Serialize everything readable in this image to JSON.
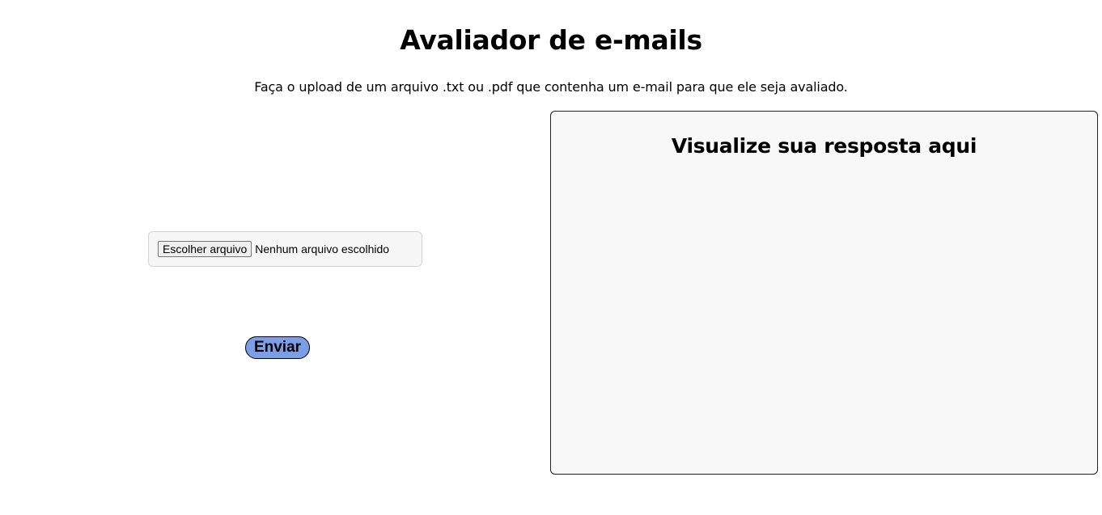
{
  "header": {
    "title": "Avaliador de e-mails",
    "subtitle": "Faça o upload de um arquivo .txt ou .pdf que contenha um e-mail para que ele seja avaliado."
  },
  "upload": {
    "button_label": "Escolher arquivo",
    "status_text": "Nenhum arquivo escolhido"
  },
  "form": {
    "submit_label": "Enviar"
  },
  "response": {
    "title": "Visualize sua resposta aqui",
    "content": ""
  },
  "colors": {
    "submit_background": "#7b9ee6",
    "panel_background": "#f8f8f8",
    "file_box_background": "#f6f6f6"
  }
}
